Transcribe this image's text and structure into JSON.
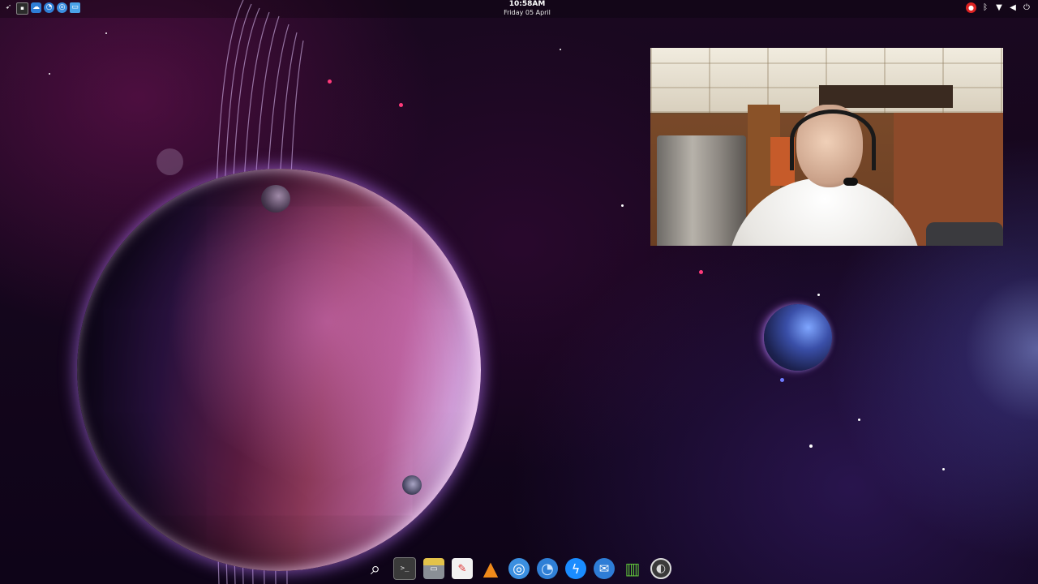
{
  "panel": {
    "clock_time": "10:58AM",
    "clock_date": "Friday 05 April",
    "launcher_icons": [
      "rocket-icon",
      "terminal-icon",
      "cloud-icon",
      "firefox-icon",
      "chromium-icon",
      "window-icon"
    ],
    "tray_icons": [
      "recording-icon",
      "bluetooth-icon",
      "wifi-icon",
      "volume-icon",
      "power-icon"
    ]
  },
  "dock": {
    "items": [
      {
        "name": "search-icon",
        "glyph": "⌕",
        "color": "#ffffff"
      },
      {
        "name": "terminal-icon",
        "glyph": ">_",
        "color": "#3a3a3a"
      },
      {
        "name": "file-manager-icon",
        "glyph": "▭",
        "color": "#8a8f96"
      },
      {
        "name": "text-editor-icon",
        "glyph": "✎",
        "color": "#f2f2f2"
      },
      {
        "name": "vlc-icon",
        "glyph": "▲",
        "color": "#f08a1a"
      },
      {
        "name": "chromium-icon",
        "glyph": "◎",
        "color": "#3b8fe0"
      },
      {
        "name": "firefox-icon",
        "glyph": "◔",
        "color": "#2f7fd6"
      },
      {
        "name": "messenger-icon",
        "glyph": "ϟ",
        "color": "#1a8cff"
      },
      {
        "name": "mail-icon",
        "glyph": "✉",
        "color": "#2e7dd6"
      },
      {
        "name": "trash-icon",
        "glyph": "🗑",
        "color": "#5fbf3a"
      },
      {
        "name": "obs-icon",
        "glyph": "◐",
        "color": "#444444"
      }
    ]
  },
  "colors": {
    "space_bg": "#14061c",
    "planet_glow": "#d7a4e0",
    "accent_blue": "#3b8fe0"
  }
}
